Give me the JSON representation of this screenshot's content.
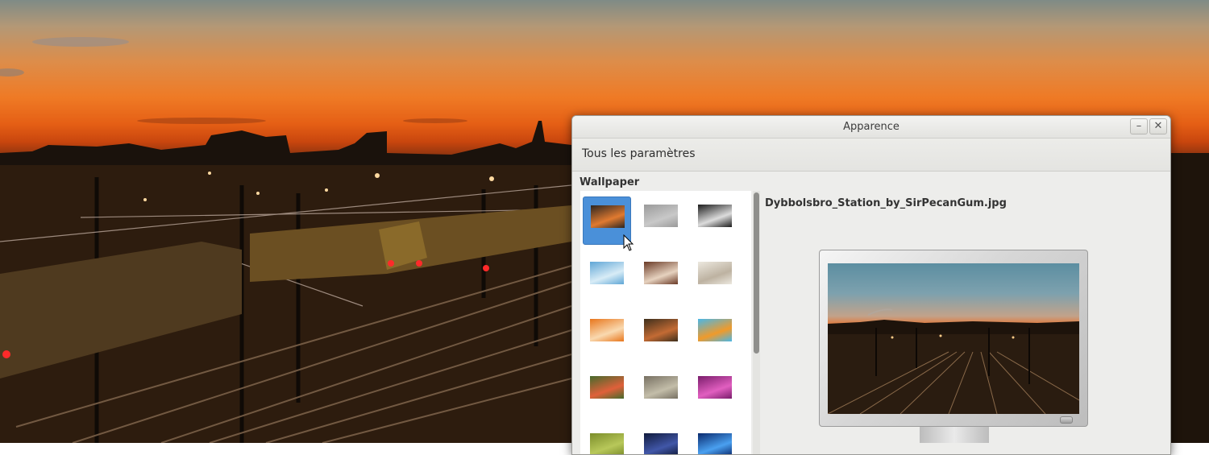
{
  "window": {
    "title": "Apparence",
    "minimize_label": "–",
    "close_label": "✕"
  },
  "toolbar": {
    "all_settings_label": "Tous les paramètres"
  },
  "wallpaper": {
    "section_label": "Wallpaper",
    "selected_filename": "Dybbolsbro_Station_by_SirPecanGum.jpg",
    "thumbnails": [
      {
        "name": "wallpaper-thumb-station",
        "c1": "#2b2520",
        "c2": "#e07a30",
        "selected": true
      },
      {
        "name": "wallpaper-thumb-fog",
        "c1": "#9a9a9a",
        "c2": "#c8c8c8",
        "selected": false
      },
      {
        "name": "wallpaper-thumb-bw",
        "c1": "#1c1c1c",
        "c2": "#dcdcdc",
        "selected": false
      },
      {
        "name": "wallpaper-thumb-ice",
        "c1": "#5fa6d6",
        "c2": "#d8ecf6",
        "selected": false
      },
      {
        "name": "wallpaper-thumb-arches",
        "c1": "#6a3a26",
        "c2": "#e6d2bf",
        "selected": false
      },
      {
        "name": "wallpaper-thumb-fossil",
        "c1": "#ece8df",
        "c2": "#bdb2a1",
        "selected": false
      },
      {
        "name": "wallpaper-thumb-orange-flower",
        "c1": "#e8761c",
        "c2": "#f9d9b0",
        "selected": false
      },
      {
        "name": "wallpaper-thumb-canyon",
        "c1": "#3e2f1c",
        "c2": "#c36b34",
        "selected": false
      },
      {
        "name": "wallpaper-thumb-graffiti",
        "c1": "#49b7e8",
        "c2": "#f09a2a",
        "selected": false
      },
      {
        "name": "wallpaper-thumb-poppies",
        "c1": "#456a2c",
        "c2": "#e0603a",
        "selected": false
      },
      {
        "name": "wallpaper-thumb-beach",
        "c1": "#777062",
        "c2": "#c3bda9",
        "selected": false
      },
      {
        "name": "wallpaper-thumb-purple",
        "c1": "#7a1d6b",
        "c2": "#e15fc0",
        "selected": false
      },
      {
        "name": "wallpaper-thumb-green",
        "c1": "#7b8d2a",
        "c2": "#b8c85a",
        "selected": false
      },
      {
        "name": "wallpaper-thumb-night",
        "c1": "#101a3c",
        "c2": "#4157a8",
        "selected": false
      },
      {
        "name": "wallpaper-thumb-blue-lights",
        "c1": "#0a2a6e",
        "c2": "#4aa0f0",
        "selected": false
      }
    ]
  },
  "colors": {
    "selection": "#4a90d9",
    "window_bg": "#ededeb"
  }
}
